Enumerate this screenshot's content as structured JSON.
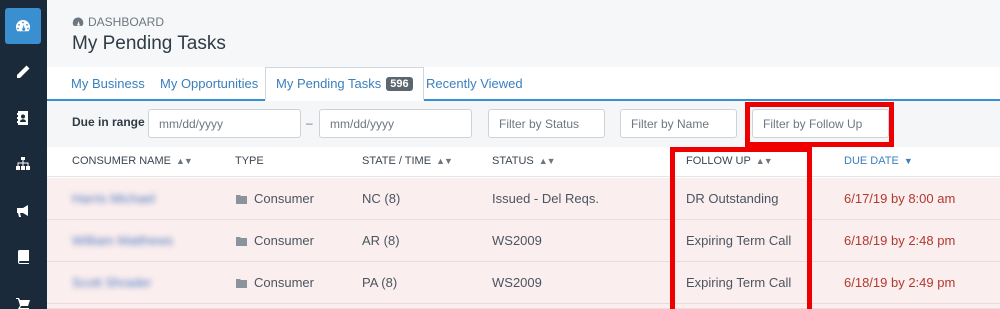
{
  "sidebar": {
    "icons": [
      "dashboard-icon",
      "pencil-icon",
      "contact-card-icon",
      "sitemap-icon",
      "bullhorn-icon",
      "book-icon",
      "cart-icon"
    ]
  },
  "header": {
    "breadcrumb": "DASHBOARD",
    "title": "My Pending Tasks"
  },
  "tabs": [
    {
      "label": "My Business"
    },
    {
      "label": "My Opportunities"
    },
    {
      "label": "My Pending Tasks",
      "badge": "596"
    },
    {
      "label": "Recently Viewed"
    }
  ],
  "filters": {
    "due_label": "Due in range",
    "date_from_placeholder": "mm/dd/yyyy",
    "separator": "–",
    "date_to_placeholder": "mm/dd/yyyy",
    "status_placeholder": "Filter by Status",
    "name_placeholder": "Filter by Name",
    "follow_up_placeholder": "Filter by Follow Up"
  },
  "table": {
    "columns": [
      "CONSUMER NAME",
      "TYPE",
      "STATE / TIME",
      "STATUS",
      "FOLLOW UP",
      "DUE DATE"
    ],
    "rows": [
      {
        "name": "Harris Michael",
        "type": "Consumer",
        "state": "NC (8)",
        "status": "Issued - Del Reqs.",
        "follow_up": "DR Outstanding",
        "due": "6/17/19 by 8:00 am"
      },
      {
        "name": "William Matthews",
        "type": "Consumer",
        "state": "AR (8)",
        "status": "WS2009",
        "follow_up": "Expiring Term Call",
        "due": "6/18/19 by 2:48 pm"
      },
      {
        "name": "Scott Shrader",
        "type": "Consumer",
        "state": "PA (8)",
        "status": "WS2009",
        "follow_up": "Expiring Term Call",
        "due": "6/18/19 by 2:49 pm"
      }
    ]
  },
  "colors": {
    "sidebar_bg": "#1b2a3a",
    "accent": "#3a8fd1",
    "row_bg": "#fbeeee",
    "due_text": "#b03a2e",
    "highlight": "#ee0000"
  }
}
